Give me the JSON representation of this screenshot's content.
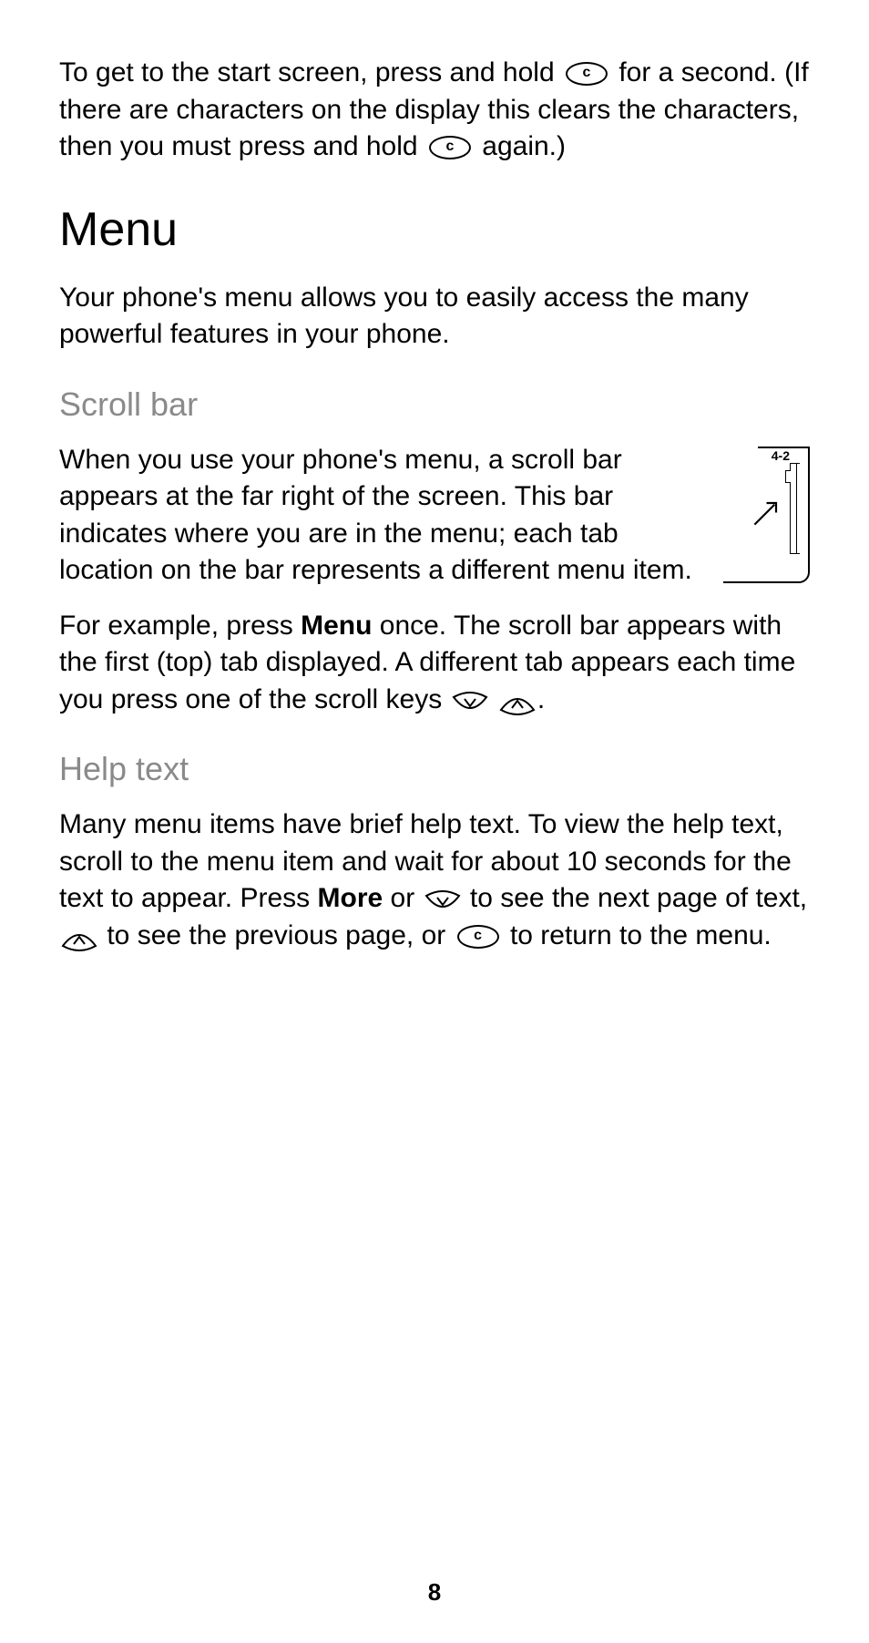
{
  "intro": {
    "p1_a": "To get to the start screen, press and hold ",
    "p1_b": " for a second. (If there are characters on the display this clears the characters, then you must press and hold ",
    "p1_c": " again.)"
  },
  "menu_heading": "Menu",
  "menu_intro": "Your phone's menu allows you to easily access the many powerful features in your phone.",
  "scrollbar": {
    "heading": "Scroll bar",
    "p1": "When you use your phone's menu, a scroll bar appears at the far right of the screen. This bar indicates where you are in the menu; each tab location on the bar represents a different menu item.",
    "p2_a": "For example, press ",
    "p2_menu": "Menu",
    "p2_b": " once. The scroll bar appears with the first (top) tab displayed. A different tab appears each time you press one of the scroll keys ",
    "p2_c": ".",
    "figure_label": "4-2"
  },
  "helptext": {
    "heading": "Help text",
    "p1_a": "Many menu items have brief help text. To view the help text, scroll to the menu item and wait for about 10 seconds for the text to appear. Press ",
    "p1_more": "More",
    "p1_b": " or ",
    "p1_c": " to see the next page of text, ",
    "p1_d": " to see the previous page, or ",
    "p1_e": " to return to the menu."
  },
  "page_number": "8"
}
